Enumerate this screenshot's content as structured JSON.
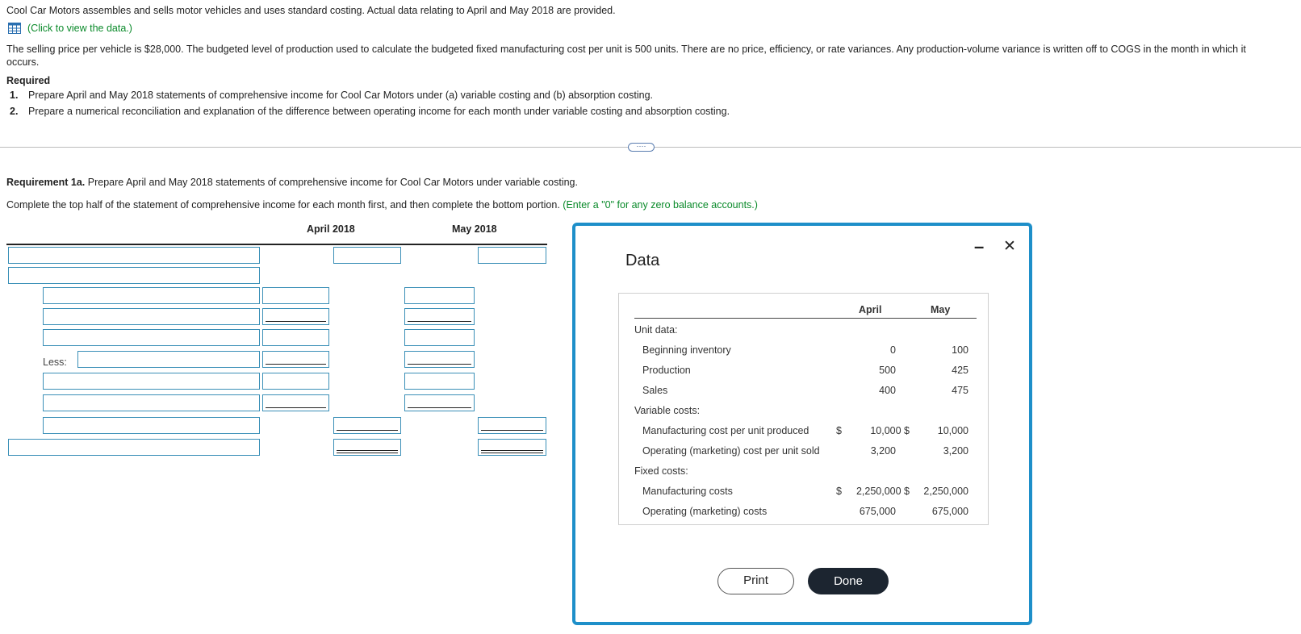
{
  "intro": {
    "line1": "Cool Car Motors assembles and sells motor vehicles and uses standard costing. Actual data relating to April and May 2018 are provided.",
    "data_link": "(Click to view the data.)",
    "para1": "The selling price per vehicle is $28,000. The budgeted level of production used to calculate the budgeted fixed manufacturing cost per unit is 500 units. There are no price, efficiency, or rate variances. Any production-volume variance is written off to COGS in the month in which it",
    "para2": "occurs.",
    "required": "Required",
    "req1_num": "1.",
    "req1": "Prepare April and May 2018 statements of comprehensive income for Cool Car Motors under (a) variable costing and (b) absorption costing.",
    "req2_num": "2.",
    "req2": "Prepare a numerical reconciliation and explanation of the difference between operating income for each month under variable costing and absorption costing."
  },
  "more_button": "····",
  "requirement": {
    "title_bold": "Requirement 1a.",
    "title_rest": " Prepare April and May 2018 statements of comprehensive income for Cool Car Motors under variable costing.",
    "instruction": "Complete the top half of the statement of comprehensive income for each month first, and then complete the bottom portion.",
    "hint": "(Enter a \"0\" for any zero balance accounts.)",
    "col_april": "April 2018",
    "col_may": "May 2018",
    "less_label": "Less:"
  },
  "modal": {
    "title": "Data",
    "minimize": "–",
    "close": "✕",
    "col_april": "April",
    "col_may": "May",
    "unit_data": "Unit data:",
    "beginning_inventory": {
      "label": "Beginning inventory",
      "april": "0",
      "may": "100"
    },
    "production": {
      "label": "Production",
      "april": "500",
      "may": "425"
    },
    "sales": {
      "label": "Sales",
      "april": "400",
      "may": "475"
    },
    "variable_costs": "Variable costs:",
    "mfg_cost_unit": {
      "label": "Manufacturing cost per unit produced",
      "cur1": "$",
      "april": "10,000 $",
      "may": "10,000"
    },
    "op_cost_unit": {
      "label": "Operating (marketing) cost per unit sold",
      "april": "3,200",
      "may": "3,200"
    },
    "fixed_costs": "Fixed costs:",
    "mfg_costs": {
      "label": "Manufacturing costs",
      "cur1": "$",
      "april": "2,250,000 $",
      "may": "2,250,000"
    },
    "op_costs": {
      "label": "Operating (marketing) costs",
      "april": "675,000",
      "may": "675,000"
    },
    "print": "Print",
    "done": "Done"
  }
}
